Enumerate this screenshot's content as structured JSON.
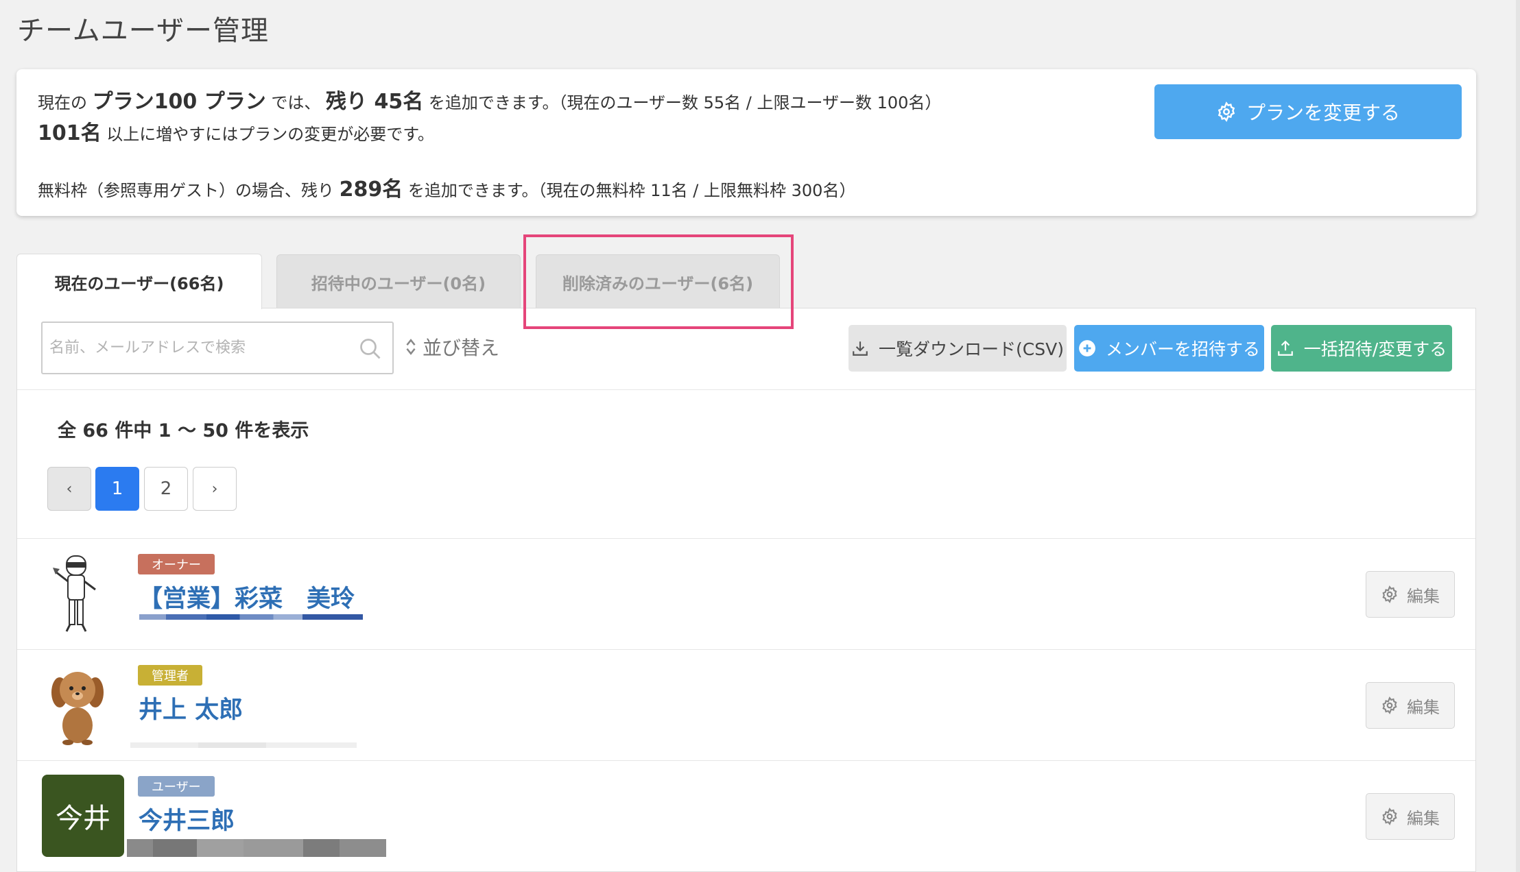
{
  "page_title": "チームユーザー管理",
  "plan": {
    "line1_prefix": "現在の",
    "plan_name": "プラン100 プラン",
    "line1_mid": "では、",
    "remaining_label": "残り 45名",
    "line1_suffix": "を追加できます。（現在のユーザー数 55名 / 上限ユーザー数 100名）",
    "line2_bold": "101名",
    "line2_suffix": "以上に増やすにはプランの変更が必要です。",
    "line3_prefix": "無料枠（参照専用ゲスト）の場合、残り",
    "line3_bold": "289名",
    "line3_suffix": "を追加できます。（現在の無料枠 11名 / 上限無料枠 300名）",
    "change_button": "プランを変更する"
  },
  "tabs": [
    {
      "label": "現在のユーザー(66名)",
      "active": true
    },
    {
      "label": "招待中のユーザー(0名)",
      "active": false
    },
    {
      "label": "削除済みのユーザー(6名)",
      "active": false
    }
  ],
  "toolbar": {
    "search_placeholder": "名前、メールアドレスで検索",
    "sort_label": "並び替え",
    "download_label": "一覧ダウンロード(CSV)",
    "invite_label": "メンバーを招待する",
    "bulk_label": "一括招待/変更する"
  },
  "list": {
    "count_text": "全 66 件中 1 〜 50 件を表示",
    "pagination": {
      "prev": "‹",
      "pages": [
        "1",
        "2"
      ],
      "current": "1",
      "next": "›"
    }
  },
  "users": [
    {
      "role": "オーナー",
      "role_color": "#c7705d",
      "name": "【営業】彩菜　美玲",
      "avatar": "robot-illustration",
      "edit_label": "編集"
    },
    {
      "role": "管理者",
      "role_color": "#c8b035",
      "name": "井上 太郎",
      "avatar": "dog-illustration",
      "edit_label": "編集"
    },
    {
      "role": "ユーザー",
      "role_color": "#8aa4c8",
      "name": "今井三郎",
      "avatar_text": "今井",
      "avatar_color": "#3a5520",
      "edit_label": "編集"
    }
  ]
}
